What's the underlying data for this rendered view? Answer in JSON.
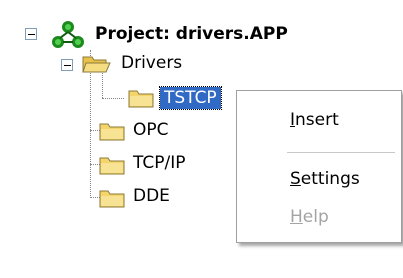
{
  "tree": {
    "root": {
      "label": "Project: drivers.APP",
      "expanded": true,
      "icon": "project-icon"
    },
    "drivers": {
      "label": "Drivers",
      "expanded": true,
      "icon": "folder-open-icon"
    },
    "tstcp": {
      "label": "TSTCP",
      "selected": true,
      "icon": "folder-icon"
    },
    "opc": {
      "label": "OPC",
      "icon": "folder-icon"
    },
    "tcpip": {
      "label": "TCP/IP",
      "icon": "folder-icon"
    },
    "dde": {
      "label": "DDE",
      "icon": "folder-icon"
    }
  },
  "context_menu": {
    "items": [
      {
        "label": "Insert",
        "mnemonic": "I",
        "enabled": true
      },
      {
        "label": "Settings",
        "mnemonic": "S",
        "enabled": true
      },
      {
        "label": "Help",
        "mnemonic": "H",
        "enabled": false
      }
    ]
  },
  "colors": {
    "selection": "#316ac5",
    "folder": "#f5d56b",
    "disabled_text": "#a4a4a4"
  }
}
